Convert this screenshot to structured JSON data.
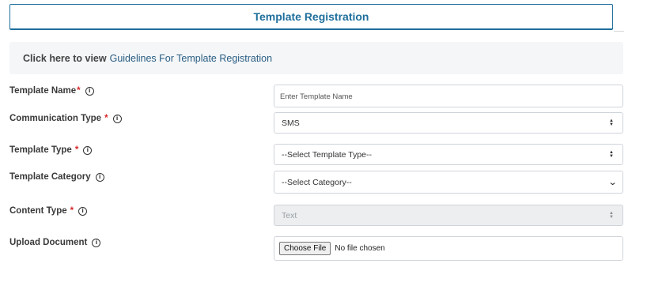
{
  "header": {
    "title": "Template Registration"
  },
  "guidelines": {
    "prefix": "Click here to view",
    "link": "Guidelines For Template Registration"
  },
  "form": {
    "template_name": {
      "label": "Template Name",
      "required": "*",
      "placeholder": "Enter Template Name",
      "value": ""
    },
    "communication_type": {
      "label": "Communication Type",
      "required": "*",
      "value": "SMS"
    },
    "template_type": {
      "label": "Template Type",
      "required": "*",
      "value": "--Select Template Type--"
    },
    "template_category": {
      "label": "Template Category",
      "value": "--Select Category--"
    },
    "content_type": {
      "label": "Content Type",
      "required": "*",
      "value": "Text"
    },
    "upload_document": {
      "label": "Upload Document",
      "button": "Choose File",
      "status": "No file chosen"
    }
  },
  "icons": {
    "info": "info-circle-icon",
    "updown": "sort-arrows-icon",
    "chevron": "chevron-down-icon"
  },
  "colors": {
    "accent": "#1f6f9c",
    "link": "#2a5d82",
    "required": "#d6282b",
    "panel": "#f4f6f8"
  }
}
